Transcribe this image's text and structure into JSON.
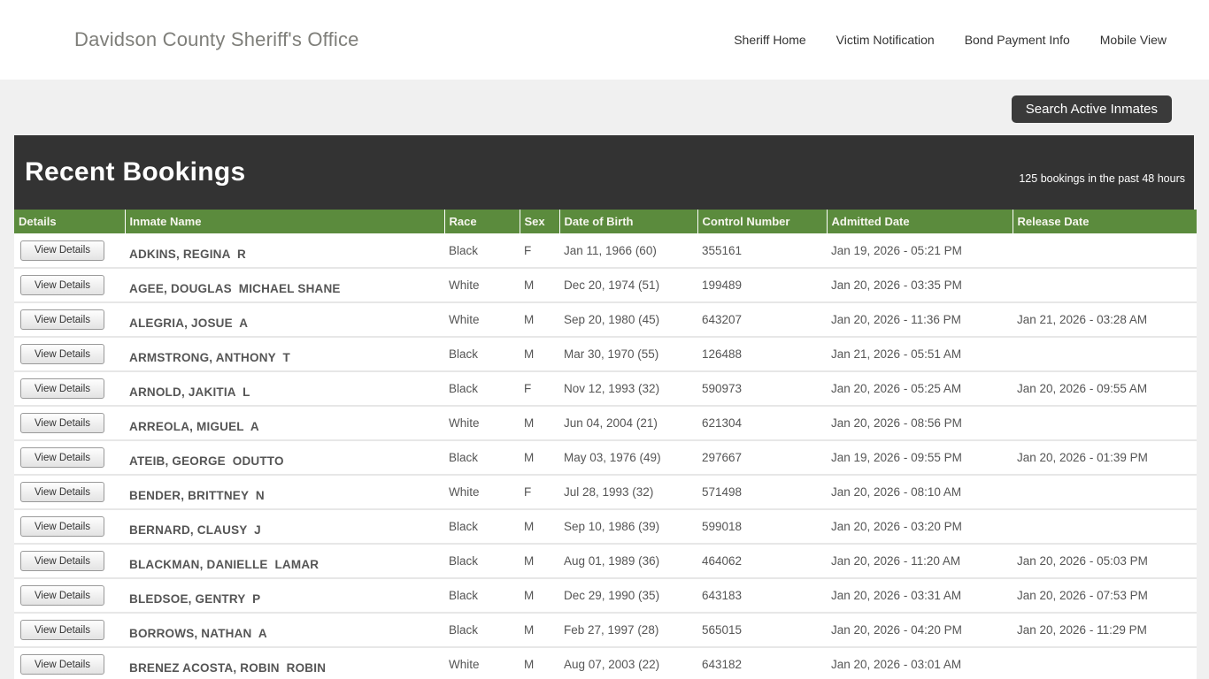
{
  "header": {
    "title": "Davidson County Sheriff's Office",
    "nav": [
      {
        "label": "Sheriff Home"
      },
      {
        "label": "Victim Notification"
      },
      {
        "label": "Bond Payment Info"
      },
      {
        "label": "Mobile View"
      }
    ]
  },
  "search_button": {
    "label": "Search Active Inmates"
  },
  "panel": {
    "title": "Recent Bookings",
    "count_text": "125 bookings in the past 48 hours"
  },
  "table": {
    "view_details_label": "View Details",
    "columns": [
      "Details",
      "Inmate Name",
      "Race",
      "Sex",
      "Date of Birth",
      "Control Number",
      "Admitted Date",
      "Release Date"
    ],
    "rows": [
      {
        "name": "ADKINS, REGINA  R",
        "race": "Black",
        "sex": "F",
        "dob": "Jan 11, 1966 (60)",
        "control": "355161",
        "admitted": "Jan 19, 2026 - 05:21 PM",
        "released": ""
      },
      {
        "name": "AGEE, DOUGLAS  MICHAEL SHANE",
        "race": "White",
        "sex": "M",
        "dob": "Dec 20, 1974 (51)",
        "control": "199489",
        "admitted": "Jan 20, 2026 - 03:35 PM",
        "released": ""
      },
      {
        "name": "ALEGRIA, JOSUE  A",
        "race": "White",
        "sex": "M",
        "dob": "Sep 20, 1980 (45)",
        "control": "643207",
        "admitted": "Jan 20, 2026 - 11:36 PM",
        "released": "Jan 21, 2026 - 03:28 AM"
      },
      {
        "name": "ARMSTRONG, ANTHONY  T",
        "race": "Black",
        "sex": "M",
        "dob": "Mar 30, 1970 (55)",
        "control": "126488",
        "admitted": "Jan 21, 2026 - 05:51 AM",
        "released": ""
      },
      {
        "name": "ARNOLD, JAKITIA  L",
        "race": "Black",
        "sex": "F",
        "dob": "Nov 12, 1993 (32)",
        "control": "590973",
        "admitted": "Jan 20, 2026 - 05:25 AM",
        "released": "Jan 20, 2026 - 09:55 AM"
      },
      {
        "name": "ARREOLA, MIGUEL  A",
        "race": "White",
        "sex": "M",
        "dob": "Jun 04, 2004 (21)",
        "control": "621304",
        "admitted": "Jan 20, 2026 - 08:56 PM",
        "released": ""
      },
      {
        "name": "ATEIB, GEORGE  ODUTTO",
        "race": "Black",
        "sex": "M",
        "dob": "May 03, 1976 (49)",
        "control": "297667",
        "admitted": "Jan 19, 2026 - 09:55 PM",
        "released": "Jan 20, 2026 - 01:39 PM"
      },
      {
        "name": "BENDER, BRITTNEY  N",
        "race": "White",
        "sex": "F",
        "dob": "Jul 28, 1993 (32)",
        "control": "571498",
        "admitted": "Jan 20, 2026 - 08:10 AM",
        "released": ""
      },
      {
        "name": "BERNARD, CLAUSY  J",
        "race": "Black",
        "sex": "M",
        "dob": "Sep 10, 1986 (39)",
        "control": "599018",
        "admitted": "Jan 20, 2026 - 03:20 PM",
        "released": ""
      },
      {
        "name": "BLACKMAN, DANIELLE  LAMAR",
        "race": "Black",
        "sex": "M",
        "dob": "Aug 01, 1989 (36)",
        "control": "464062",
        "admitted": "Jan 20, 2026 - 11:20 AM",
        "released": "Jan 20, 2026 - 05:03 PM"
      },
      {
        "name": "BLEDSOE, GENTRY  P",
        "race": "Black",
        "sex": "M",
        "dob": "Dec 29, 1990 (35)",
        "control": "643183",
        "admitted": "Jan 20, 2026 - 03:31 AM",
        "released": "Jan 20, 2026 - 07:53 PM"
      },
      {
        "name": "BORROWS, NATHAN  A",
        "race": "Black",
        "sex": "M",
        "dob": "Feb 27, 1997 (28)",
        "control": "565015",
        "admitted": "Jan 20, 2026 - 04:20 PM",
        "released": "Jan 20, 2026 - 11:29 PM"
      },
      {
        "name": "BRENEZ ACOSTA, ROBIN  ROBIN",
        "race": "White",
        "sex": "M",
        "dob": "Aug 07, 2003 (22)",
        "control": "643182",
        "admitted": "Jan 20, 2026 - 03:01 AM",
        "released": ""
      }
    ]
  },
  "colors": {
    "accent_green": "#5b8b3d",
    "dark_bar": "#333333",
    "page_background": "#f0f0f0"
  }
}
